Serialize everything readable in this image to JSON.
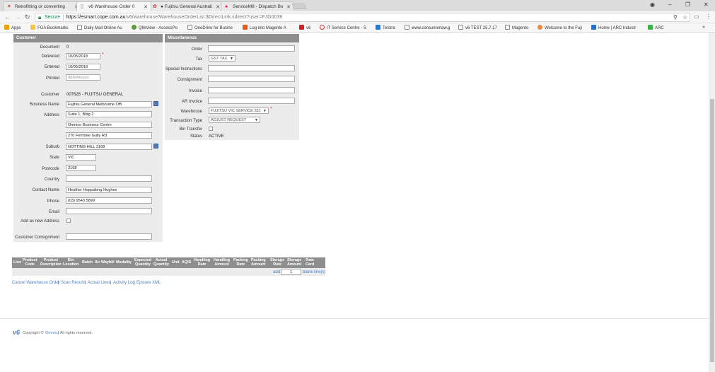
{
  "browser": {
    "tabs": [
      {
        "title": "Retrofitting or converting",
        "icon": "wolf-icon"
      },
      {
        "title": "v6 Warehouse Order 0",
        "icon": "document-icon"
      },
      {
        "title": "● Fujitsu General Australi",
        "icon": "fujitsu-icon"
      },
      {
        "title": "ServiceM8 - Dispatch Bo",
        "icon": "servicem8-icon"
      }
    ],
    "secure_label": "Secure",
    "url_host": "https://esmart.cope.com.au",
    "url_path": "/v6/warehouse/WarehouseOrderList.$DirectLink.sdirect?user=FJG0039",
    "bookmarks": [
      "Apps",
      "FGA Bookmarks",
      "Daily Mail Online Au",
      "QlikView - AccessPo",
      "OneDrive for Busine",
      "Log into Magento A",
      "v6",
      "IT Service Centre - S",
      "Telstra",
      "www.consumerlaw.g",
      "v6 TEST 25.7.17",
      "Magento",
      "Welcome to the Fuji",
      "Home | ARC Industr",
      "ARC"
    ],
    "colors": {
      "secure": "#0b8043",
      "link": "#4a7fc1",
      "panel_header": "#8e8e8e"
    }
  },
  "customer": {
    "header": "Customer",
    "document_label": "Document",
    "document_value": "0",
    "delivered_label": "Delivered",
    "delivered_value": "10/05/2018",
    "entered_label": "Entered",
    "entered_value": "10/05/2018",
    "printed_label": "Printed",
    "printed_placeholder": "dd/MM/yyyy",
    "customer_label": "Customer",
    "customer_value": "007628 - FUJITSU GENERAL",
    "business_name_label": "Business Name",
    "business_name_value": "Fujitsu General Melbourne Offi",
    "address_label": "Address",
    "address_line1": "Suite 1, Bldg 2",
    "address_line2": "Omnico Business Centre",
    "address_line3": "270 Ferntree Gully Rd",
    "suburb_label": "Suburb",
    "suburb_value": "NOTTING HILL 3168",
    "state_label": "State",
    "state_value": "VIC",
    "postcode_label": "Postcode",
    "postcode_value": "3168",
    "country_label": "Country",
    "country_value": "",
    "contact_name_label": "Contact Name",
    "contact_name_value": "Heather Hoppalong Hughes",
    "phone_label": "Phone",
    "phone_value": "(03) 9543 5899",
    "email_label": "Email",
    "email_value": "",
    "add_new_address_label": "Add as new Address",
    "customer_consignment_label": "Customer Consignment",
    "customer_consignment_value": ""
  },
  "misc": {
    "header": "Miscellaneous",
    "order_label": "Order",
    "tax_label": "Tax",
    "tax_value": "GST TAX",
    "special_instructions_label": "Special Instructions",
    "consignment_label": "Consignment",
    "invoice_label": "Invoice",
    "ar_invoice_label": "AR Invoice",
    "warehouse_label": "Warehouse",
    "warehouse_value": "FUJITSU VIC SERVICE 331",
    "transaction_type_label": "Transaction Type",
    "transaction_type_value": "ADJUST REQUEST",
    "bin_transfer_label": "Bin Transfer",
    "status_label": "Status",
    "status_value": "ACTIVE"
  },
  "lines": {
    "columns": [
      "Line",
      "Product\nCode",
      "Product\nDescription",
      "Bin\nLocation",
      "Batch",
      "Air Waybill",
      "Modality",
      "Expected\nQuantity",
      "Actual\nQuantity",
      "Unit",
      "AQIS",
      "Handling\nRate",
      "Handling\nAmount",
      "Packing\nRate",
      "Packing\nAmount",
      "Storage\nRate",
      "Storage\nAmount",
      "Rate\nCard"
    ],
    "add_label": "add",
    "add_count": "1",
    "blank_lines_label": "blank line(s)"
  },
  "actions": {
    "cancel": "Cancel Warehouse Order",
    "scan_results": "Scan Results",
    "actual_lines": "Actual Lines",
    "activity_log": "Activity Log",
    "epicore_xml": "Epicore XML",
    "separator": "|"
  },
  "footer": {
    "logo": "v6",
    "copyright_prefix": "Copyright ©",
    "company": "Omnico",
    "rights": "| All rights reserved."
  }
}
